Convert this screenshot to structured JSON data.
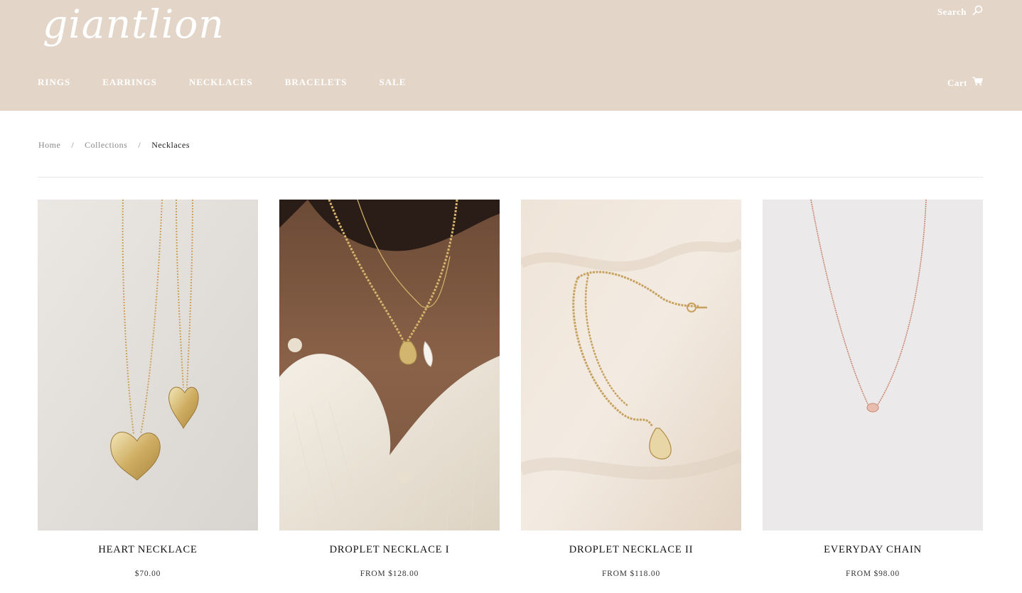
{
  "brand": {
    "logo": "giantlion"
  },
  "header": {
    "search_label": "Search",
    "cart_label": "Cart",
    "nav": [
      "RINGS",
      "EARRINGS",
      "NECKLACES",
      "BRACELETS",
      "SALE"
    ]
  },
  "breadcrumb": {
    "home": "Home",
    "sep": "/",
    "collections": "Collections",
    "current": "Necklaces"
  },
  "products": [
    {
      "name": "HEART NECKLACE",
      "price": "$70.00"
    },
    {
      "name": "DROPLET NECKLACE I",
      "price": "FROM $128.00"
    },
    {
      "name": "DROPLET NECKLACE II",
      "price": "FROM $118.00"
    },
    {
      "name": "EVERYDAY CHAIN",
      "price": "FROM $98.00"
    }
  ],
  "colors": {
    "header_bg": "#e3d6c8",
    "header_text": "#ffffff",
    "gold": "#c9a35c",
    "rose": "#c98a74"
  },
  "icons": {
    "search": "search-icon",
    "cart": "cart-icon"
  }
}
